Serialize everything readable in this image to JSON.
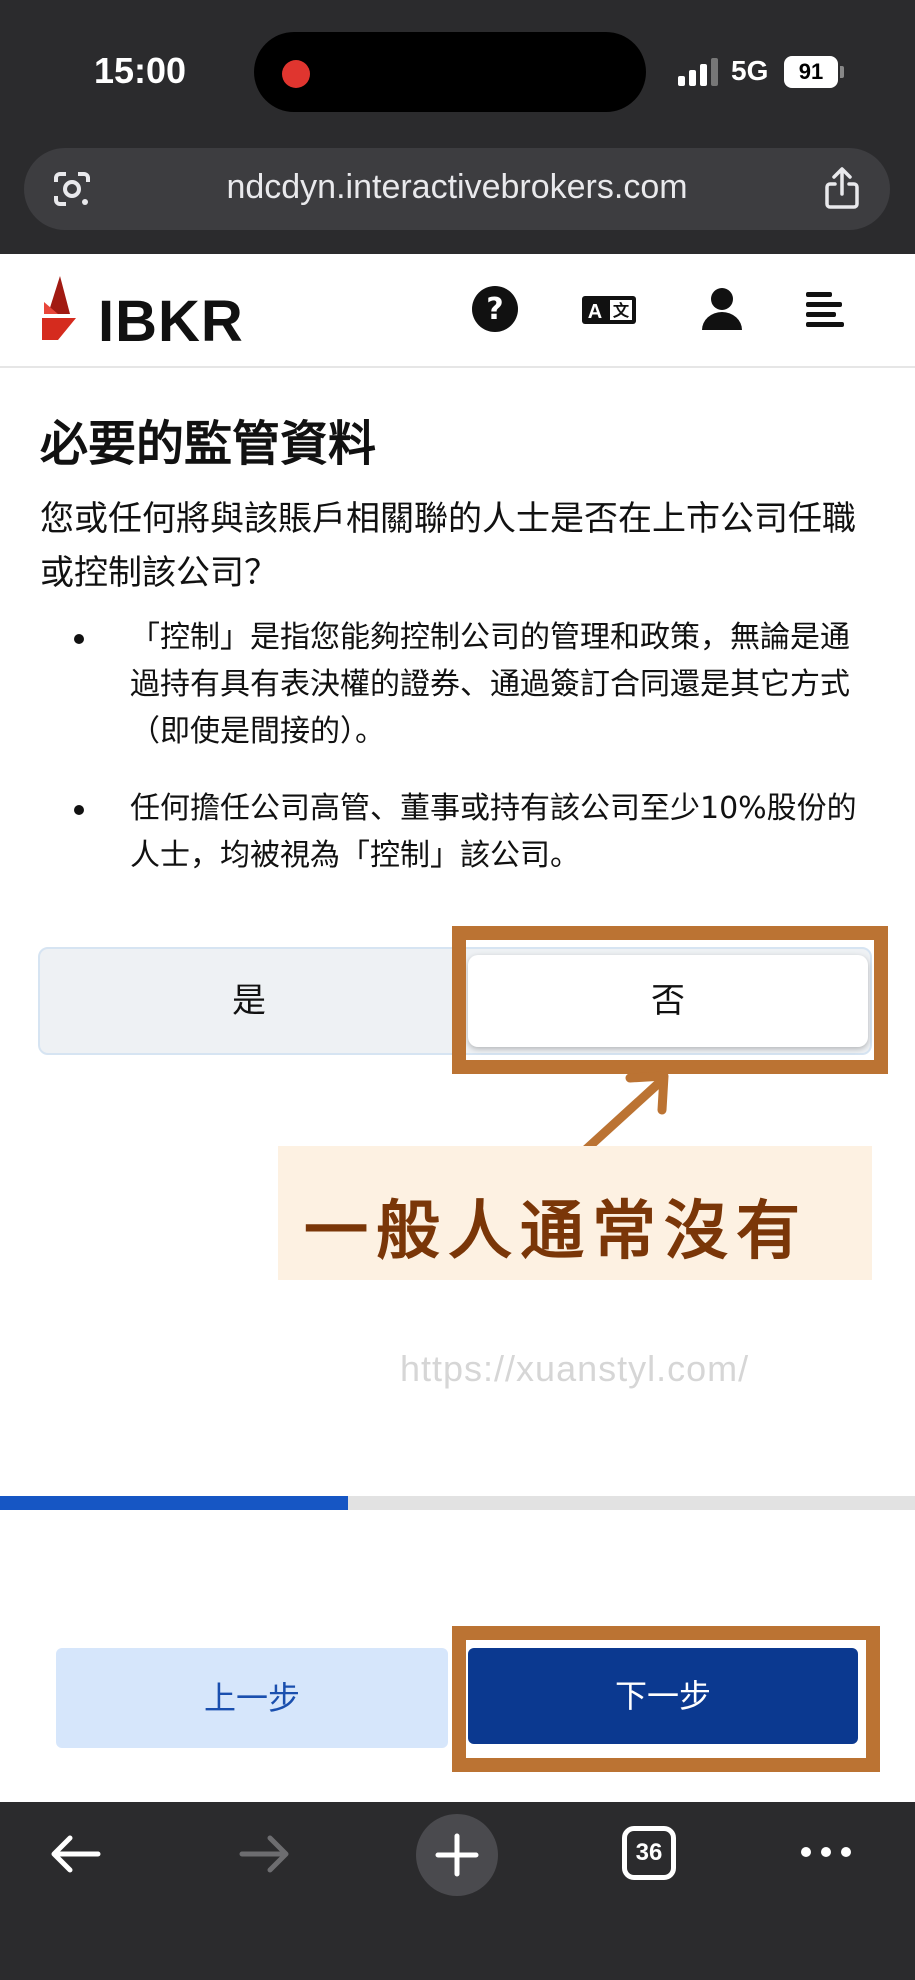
{
  "status_bar": {
    "time": "15:00",
    "network": "5G",
    "battery": "91"
  },
  "browser": {
    "url": "ndcdyn.interactivebrokers.com",
    "tab_count": "36"
  },
  "header": {
    "logo_text": "IBKR",
    "icons": [
      "help-icon",
      "language-icon",
      "user-icon",
      "menu-icon"
    ]
  },
  "content": {
    "title": "必要的監管資料",
    "question": "您或任何將與該賬戶相關聯的人士是否在上市公司任職或控制該公司？",
    "bullets": [
      "「控制」是指您能夠控制公司的管理和政策，無論是通過持有具有表決權的證券、通過簽訂合同還是其它方式（即使是間接的）。",
      "任何擔任公司高管、董事或持有該公司至少10%股份的人士，均被視為「控制」該公司。"
    ],
    "options": {
      "yes": "是",
      "no": "否",
      "selected": "no"
    }
  },
  "annotation": {
    "note": "一般人通常沒有",
    "color": "#bb7333"
  },
  "watermark": "https://xuanstyl.com/",
  "progress": {
    "fraction": 0.38
  },
  "buttons": {
    "back": "上一步",
    "next": "下一步"
  },
  "colors": {
    "brand_red": "#d52b1e",
    "primary_blue": "#0b3990",
    "progress_blue": "#1656c4"
  }
}
